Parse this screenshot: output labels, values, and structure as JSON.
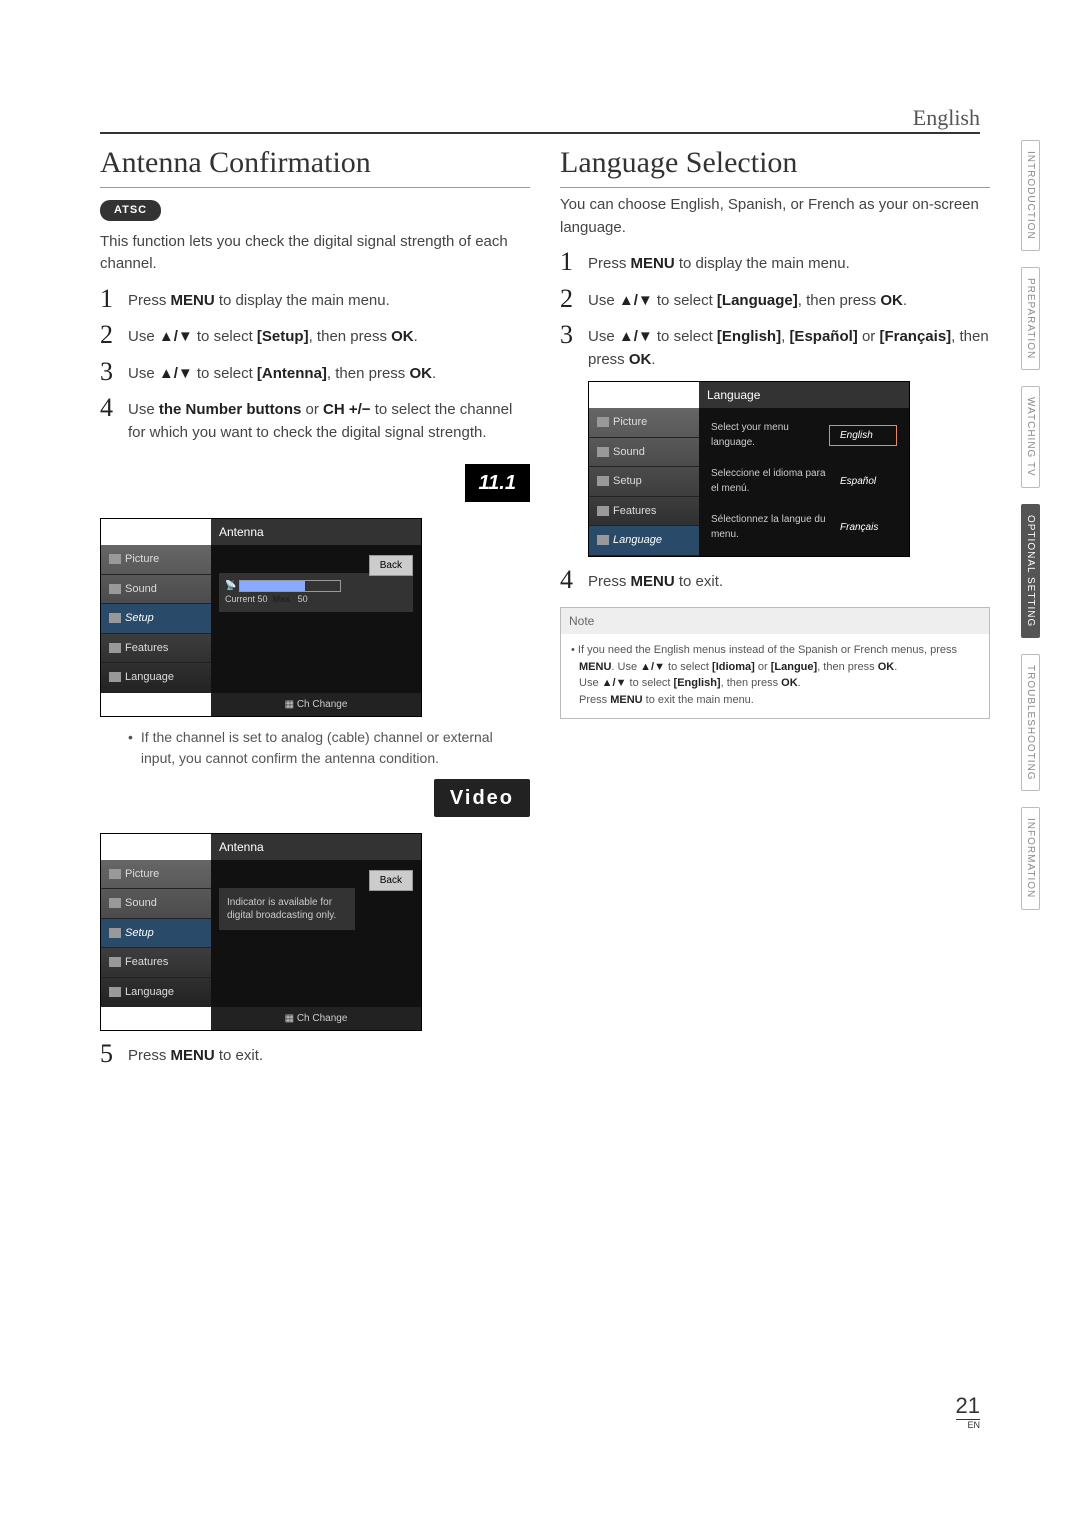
{
  "header_lang": "English",
  "sidetabs": [
    "INTRODUCTION",
    "PREPARATION",
    "WATCHING TV",
    "OPTIONAL SETTING",
    "TROUBLESHOOTING",
    "INFORMATION"
  ],
  "sidetab_active_index": 3,
  "page_number": "21",
  "page_suffix": "EN",
  "left": {
    "title": "Antenna Confirmation",
    "atsc_badge": "ATSC",
    "intro": "This function lets you check the digital signal strength of each channel.",
    "step1": "Press ",
    "step1b": "MENU",
    "step1c": " to display the main menu.",
    "step2a": "Use ",
    "step2arrows": "▲/▼",
    "step2b": " to select ",
    "step2key": "[Setup]",
    "step2c": ", then press ",
    "step2ok": "OK",
    "step2d": ".",
    "step3a": "Use ",
    "step3arrows": "▲/▼",
    "step3b": " to select ",
    "step3key": "[Antenna]",
    "step3c": ", then press ",
    "step3ok": "OK",
    "step3d": ".",
    "step4a": "Use ",
    "step4b": "the Number buttons",
    "step4c": " or ",
    "step4d": "CH +/−",
    "step4e": "  to select the channel for which you want to check the digital signal strength.",
    "channel_display": "11.1",
    "osd1": {
      "header": "Antenna",
      "menu": [
        "Picture",
        "Sound",
        "Setup",
        "Features",
        "Language"
      ],
      "active_index": 2,
      "back": "Back",
      "current_label": "Current",
      "current_val": "50",
      "max_label": "Max",
      "max_val": "50",
      "footer": "Ch Change"
    },
    "bullet1": "If the channel is set to analog (cable) channel or external input, you cannot confirm the antenna condition.",
    "video_display": "Video",
    "osd2": {
      "header": "Antenna",
      "menu": [
        "Picture",
        "Sound",
        "Setup",
        "Features",
        "Language"
      ],
      "active_index": 2,
      "back": "Back",
      "indicator_msg": "Indicator is available for digital broadcasting only.",
      "footer": "Ch Change"
    },
    "step5a": "Press ",
    "step5b": "MENU",
    "step5c": " to exit."
  },
  "right": {
    "title": "Language Selection",
    "intro": "You can choose English, Spanish, or French as your on-screen language.",
    "step1a": "Press ",
    "step1b": "MENU",
    "step1c": " to display the main menu.",
    "step2a": "Use ",
    "step2arrows": "▲/▼",
    "step2b": " to select ",
    "step2key": "[Language]",
    "step2c": ", then press ",
    "step2ok": "OK",
    "step2d": ".",
    "step3a": "Use ",
    "step3arrows": "▲/▼",
    "step3b": " to select ",
    "step3k1": "[English]",
    "step3m1": ", ",
    "step3k2": "[Español]",
    "step3m2": " or ",
    "step3k3": "[Français]",
    "step3c": ", then press ",
    "step3ok": "OK",
    "step3d": ".",
    "osd": {
      "header": "Language",
      "menu": [
        "Picture",
        "Sound",
        "Setup",
        "Features",
        "Language"
      ],
      "active_index": 4,
      "rows": [
        {
          "prompt": "Select your menu language.",
          "opt": "English",
          "sel": true
        },
        {
          "prompt": "Seleccione el idioma para el menú.",
          "opt": "Español",
          "sel": false
        },
        {
          "prompt": "Sélectionnez la langue du menu.",
          "opt": "Français",
          "sel": false
        }
      ]
    },
    "step4a": "Press ",
    "step4b": "MENU",
    "step4c": " to exit.",
    "note_header": "Note",
    "note_line1a": "• If you need the English menus instead of the Spanish or French menus, press ",
    "note_menu": "MENU",
    "note_l1b": ". Use ",
    "note_arrows": "▲/▼",
    "note_l1c": " to select ",
    "note_idioma": "[Idioma]",
    "note_or": " or ",
    "note_langue": "[Langue]",
    "note_then": ", then press ",
    "note_ok": "OK",
    "note_dot": ".",
    "note_line2a": "Use ",
    "note_line2b": " to select ",
    "note_english": "[English]",
    "note_line2c": ", then press ",
    "note_line2d": ".",
    "note_line3a": "Press ",
    "note_line3b": " to exit the main menu."
  }
}
